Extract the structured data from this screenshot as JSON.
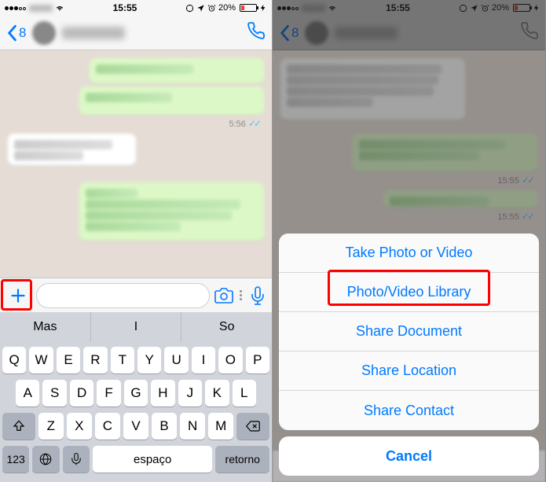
{
  "status": {
    "time": "15:55",
    "battery_pct": "20%"
  },
  "nav": {
    "back_count": "8"
  },
  "left": {
    "outgoing_time": "5:56"
  },
  "right": {
    "ts1": "15:55",
    "ts2": "15:55"
  },
  "suggestions": [
    "Mas",
    "I",
    "So"
  ],
  "keyboard": {
    "row1": [
      "Q",
      "W",
      "E",
      "R",
      "T",
      "Y",
      "U",
      "I",
      "O",
      "P"
    ],
    "row2": [
      "A",
      "S",
      "D",
      "F",
      "G",
      "H",
      "J",
      "K",
      "L"
    ],
    "row3": [
      "Z",
      "X",
      "C",
      "V",
      "B",
      "N",
      "M"
    ],
    "nums": "123",
    "space": "espaço",
    "ret": "retorno"
  },
  "sheet": {
    "take": "Take Photo or Video",
    "library": "Photo/Video Library",
    "doc": "Share Document",
    "loc": "Share Location",
    "contact": "Share Contact",
    "cancel": "Cancel"
  }
}
